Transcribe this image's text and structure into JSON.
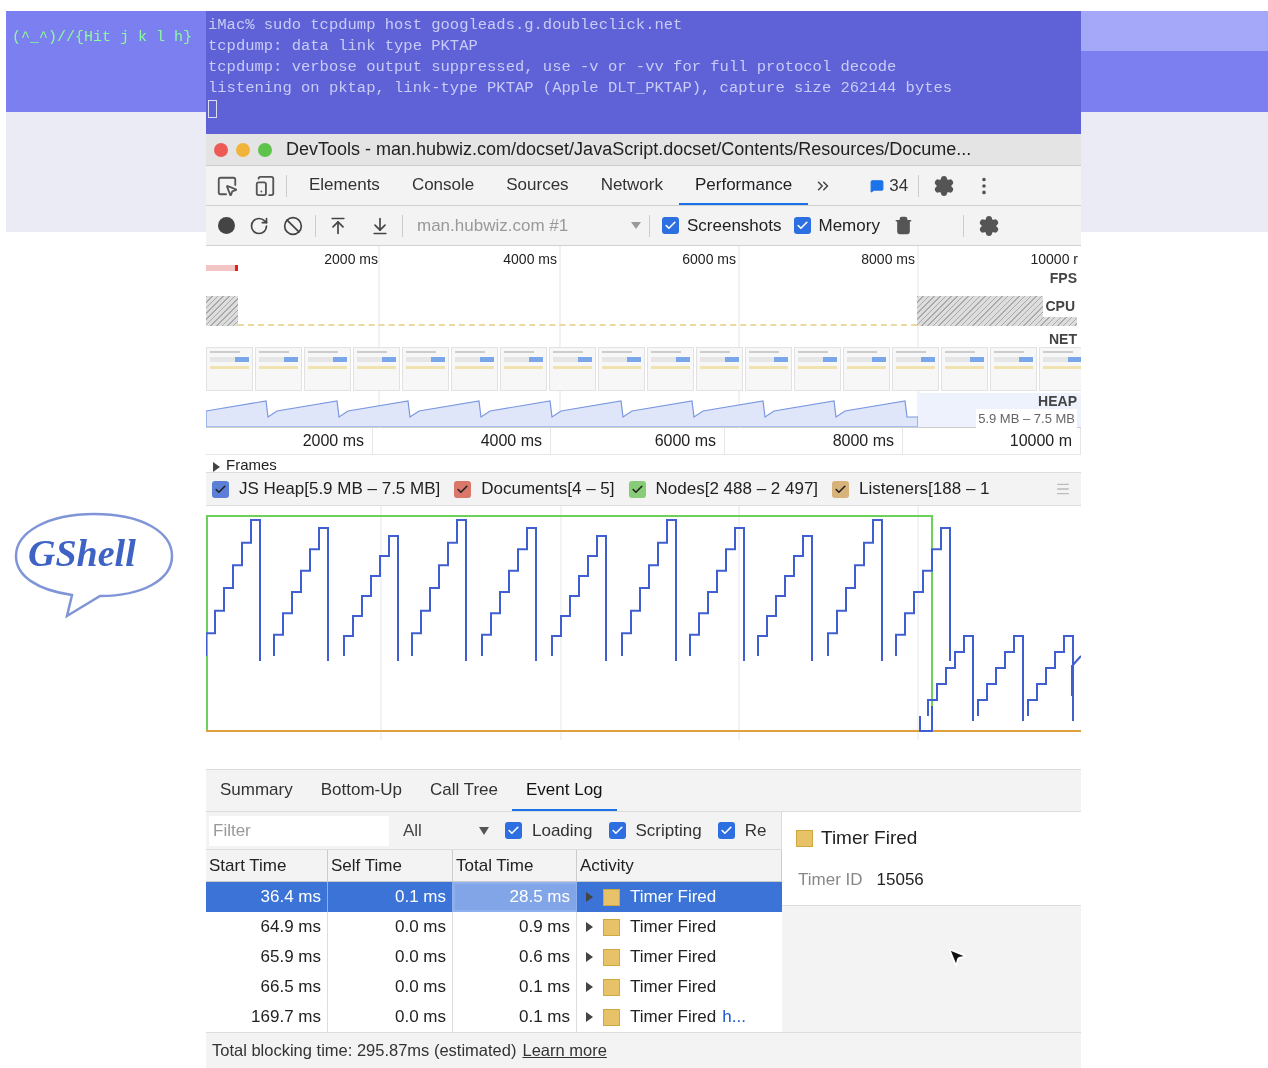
{
  "overlay_hint": "(^_^)//{Hit j k l h}",
  "terminal": {
    "lines": [
      "iMac% sudo tcpdump host googleads.g.doubleclick.net",
      "tcpdump: data link type PKTAP",
      "tcpdump: verbose output suppressed, use -v or -vv for full protocol decode",
      "listening on pktap, link-type PKTAP (Apple DLT_PKTAP), capture size 262144 bytes"
    ]
  },
  "logo": {
    "text": "GShell"
  },
  "window": {
    "title": "DevTools - man.hubwiz.com/docset/JavaScript.docset/Contents/Resources/Docume..."
  },
  "tabs": [
    {
      "label": "Elements",
      "selected": false
    },
    {
      "label": "Console",
      "selected": false
    },
    {
      "label": "Sources",
      "selected": false
    },
    {
      "label": "Network",
      "selected": false
    },
    {
      "label": "Performance",
      "selected": true
    }
  ],
  "issues_count": "34",
  "toolbar": {
    "recording": "man.hubwiz.com #1",
    "options": [
      {
        "label": "Screenshots",
        "checked": true
      },
      {
        "label": "Memory",
        "checked": true
      }
    ]
  },
  "overview": {
    "ticks": [
      "2000 ms",
      "4000 ms",
      "6000 ms",
      "8000 ms",
      "10000 r"
    ],
    "tracks": [
      "FPS",
      "CPU",
      "NET",
      "HEAP"
    ],
    "heap_range": "5.9 MB – 7.5 MB"
  },
  "ruler": {
    "ticks": [
      "2000 ms",
      "4000 ms",
      "6000 ms",
      "8000 ms",
      "10000 m"
    ]
  },
  "frames": {
    "label": "Frames",
    "expanded": false
  },
  "counters": [
    {
      "label": "JS Heap[5.9 MB – 7.5 MB]",
      "checked": true,
      "color": "#5b7fd6"
    },
    {
      "label": "Documents[4 – 5]",
      "checked": true,
      "color": "#d9776b"
    },
    {
      "label": "Nodes[2 488 – 2 497]",
      "checked": true,
      "color": "#88cc77"
    },
    {
      "label": "Listeners[188 – 1",
      "checked": true,
      "color": "#d7b27a"
    }
  ],
  "bottom_tabs": [
    {
      "label": "Summary",
      "selected": false
    },
    {
      "label": "Bottom-Up",
      "selected": false
    },
    {
      "label": "Call Tree",
      "selected": false
    },
    {
      "label": "Event Log",
      "selected": true
    }
  ],
  "filter": {
    "placeholder": "Filter",
    "level": "All",
    "categories": [
      {
        "label": "Loading",
        "checked": true
      },
      {
        "label": "Scripting",
        "checked": true
      },
      {
        "label": "Re",
        "checked": true
      }
    ]
  },
  "table": {
    "columns": [
      "Start Time",
      "Self Time",
      "Total Time",
      "Activity"
    ],
    "rows": [
      {
        "start": "36.4 ms",
        "self": "0.1 ms",
        "total": "28.5 ms",
        "activity": "Timer Fired",
        "selected": true
      },
      {
        "start": "64.9 ms",
        "self": "0.0 ms",
        "total": "0.9 ms",
        "activity": "Timer Fired",
        "selected": false
      },
      {
        "start": "65.9 ms",
        "self": "0.0 ms",
        "total": "0.6 ms",
        "activity": "Timer Fired",
        "selected": false
      },
      {
        "start": "66.5 ms",
        "self": "0.0 ms",
        "total": "0.1 ms",
        "activity": "Timer Fired",
        "selected": false
      },
      {
        "start": "169.7 ms",
        "self": "0.0 ms",
        "total": "0.1 ms",
        "activity": "Timer Fired",
        "link": "h...",
        "selected": false
      }
    ]
  },
  "details": {
    "title": "Timer Fired",
    "fields": [
      {
        "label": "Timer ID",
        "value": "15056"
      }
    ]
  },
  "footer": {
    "text": "Total blocking time: 295.87ms (estimated)",
    "link": "Learn more"
  }
}
